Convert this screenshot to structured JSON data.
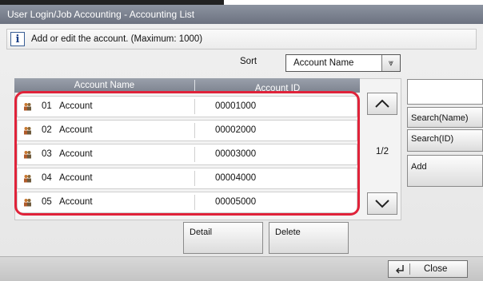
{
  "window": {
    "title": "User Login/Job Accounting - Accounting List"
  },
  "message": {
    "icon": "info-icon",
    "text": "Add or edit the account. (Maximum: 1000)"
  },
  "sort": {
    "label": "Sort",
    "selected": "Account Name",
    "chevron": "⩔"
  },
  "table": {
    "columns": [
      "Account Name",
      "Account ID"
    ],
    "rows": [
      {
        "number": "01",
        "name": "Account",
        "id": "00001000"
      },
      {
        "number": "02",
        "name": "Account",
        "id": "00002000"
      },
      {
        "number": "03",
        "name": "Account",
        "id": "00003000"
      },
      {
        "number": "04",
        "name": "Account",
        "id": "00004000"
      },
      {
        "number": "05",
        "name": "Account",
        "id": "00005000"
      }
    ],
    "page": "1/2"
  },
  "side": {
    "search_name": "Search(Name)",
    "search_id": "Search(ID)",
    "add": "Add"
  },
  "actions": {
    "detail": "Detail",
    "delete": "Delete"
  },
  "footer": {
    "close": "Close"
  },
  "colors": {
    "highlight": "#e0233a",
    "titlebar": "#7d838f"
  }
}
